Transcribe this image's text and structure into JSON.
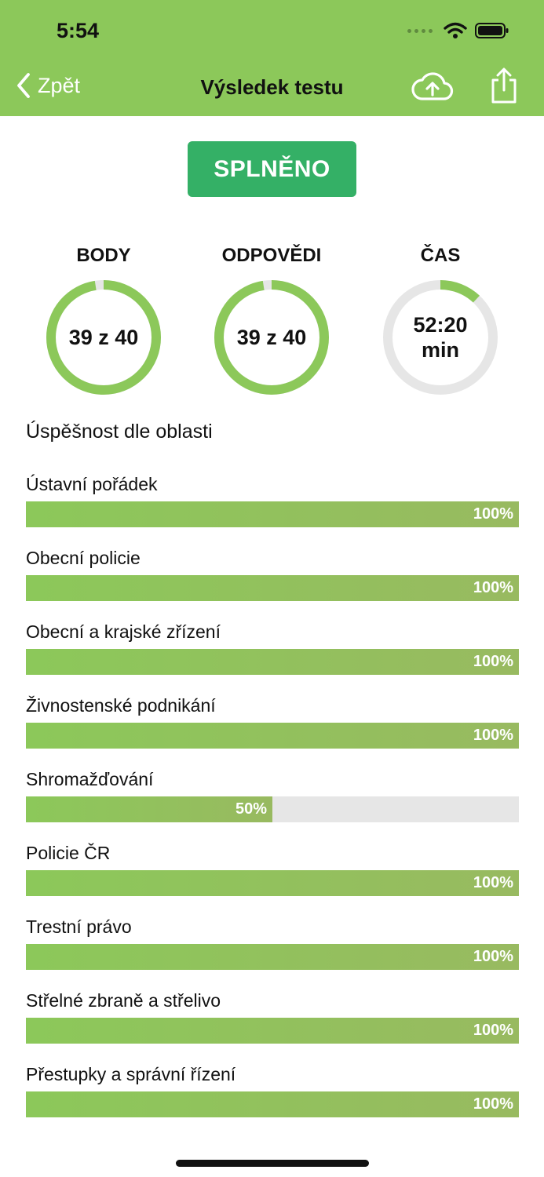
{
  "status_bar": {
    "time": "5:54"
  },
  "nav": {
    "back_label": "Zpět",
    "title": "Výsledek testu",
    "upload_icon": "cloud-upload-icon",
    "share_icon": "share-icon"
  },
  "result": {
    "badge": "SPLNĚNO",
    "badge_color": "#34B066"
  },
  "stats": [
    {
      "title": "BODY",
      "value": "39 z 40",
      "progress": 0.975
    },
    {
      "title": "ODPOVĚDI",
      "value": "39 z 40",
      "progress": 0.975
    },
    {
      "title": "ČAS",
      "value_line1": "52:20",
      "value_line2": "min",
      "progress": 0.12
    }
  ],
  "section_title": "Úspěšnost dle oblasti",
  "categories": [
    {
      "label": "Ústavní pořádek",
      "percent_text": "100%",
      "fraction": 1.0
    },
    {
      "label": "Obecní policie",
      "percent_text": "100%",
      "fraction": 1.0
    },
    {
      "label": "Obecní a krajské zřízení",
      "percent_text": "100%",
      "fraction": 1.0
    },
    {
      "label": "Živnostenské podnikání",
      "percent_text": "100%",
      "fraction": 1.0
    },
    {
      "label": "Shromažďování",
      "percent_text": "50%",
      "fraction": 0.5
    },
    {
      "label": "Policie ČR",
      "percent_text": "100%",
      "fraction": 1.0
    },
    {
      "label": "Trestní právo",
      "percent_text": "100%",
      "fraction": 1.0
    },
    {
      "label": "Střelné zbraně a střelivo",
      "percent_text": "100%",
      "fraction": 1.0
    },
    {
      "label": "Přestupky a správní řízení",
      "percent_text": "100%",
      "fraction": 1.0
    }
  ],
  "colors": {
    "header": "#8CC85A",
    "accent": "#8CC85A",
    "track": "#E6E6E6",
    "badge": "#34B066"
  }
}
